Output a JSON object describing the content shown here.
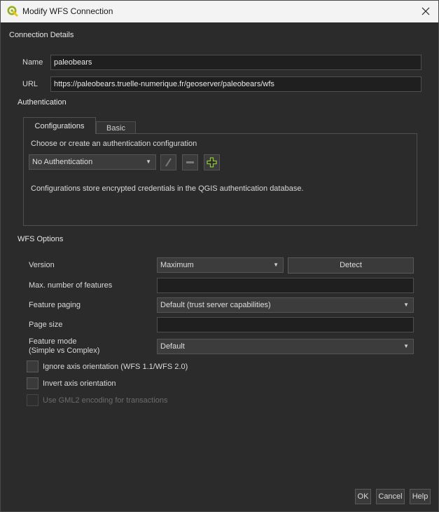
{
  "window": {
    "title": "Modify WFS Connection"
  },
  "connection": {
    "section": "Connection Details",
    "name_label": "Name",
    "name_value": "paleobears",
    "url_label": "URL",
    "url_value": "https://paleobears.truelle-numerique.fr/geoserver/paleobears/wfs"
  },
  "auth": {
    "section": "Authentication",
    "tabs": [
      "Configurations",
      "Basic"
    ],
    "prompt": "Choose or create an authentication configuration",
    "selected": "No Authentication",
    "info": "Configurations store encrypted credentials in the QGIS authentication database."
  },
  "wfs": {
    "section": "WFS Options",
    "version_label": "Version",
    "version_value": "Maximum",
    "detect_label": "Detect",
    "max_features_label": "Max. number of features",
    "max_features_value": "",
    "paging_label": "Feature paging",
    "paging_value": "Default (trust server capabilities)",
    "page_size_label": "Page size",
    "page_size_value": "",
    "feature_mode_label_1": "Feature mode",
    "feature_mode_label_2": "(Simple vs Complex)",
    "feature_mode_value": "Default",
    "ignore_axis_label": "Ignore axis orientation (WFS 1.1/WFS 2.0)",
    "invert_axis_label": "Invert axis orientation",
    "gml2_label": "Use GML2 encoding for transactions"
  },
  "buttons": {
    "ok": "OK",
    "cancel": "Cancel",
    "help": "Help"
  },
  "colors": {
    "accent_green": "#8fc43d",
    "background": "#2b2b2b"
  }
}
